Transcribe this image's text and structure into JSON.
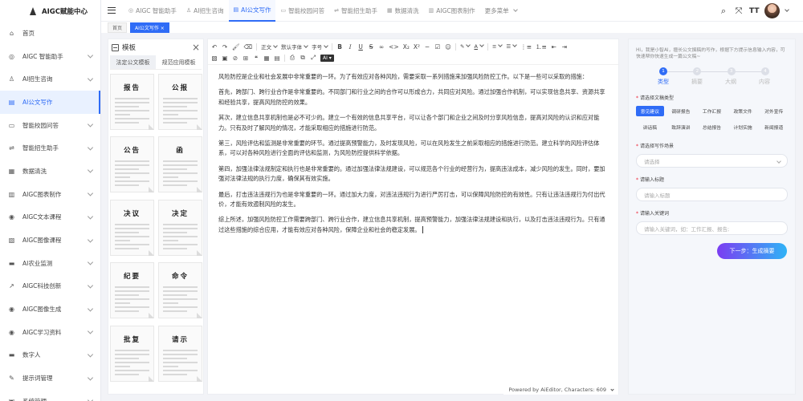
{
  "app": {
    "title": "AIGC赋能中心"
  },
  "sidebar": {
    "items": [
      {
        "label": "首页",
        "icon": "home-icon",
        "glyph": "⌂"
      },
      {
        "label": "AIGC 智能助手",
        "icon": "github-icon",
        "glyph": "◎"
      },
      {
        "label": "AI招生咨询",
        "icon": "user-icon",
        "glyph": "♙"
      },
      {
        "label": "AI公文写作",
        "icon": "document-icon",
        "glyph": "▤"
      },
      {
        "label": "智能校园问答",
        "icon": "chat-icon",
        "glyph": "▭"
      },
      {
        "label": "智能招生助手",
        "icon": "switch-icon",
        "glyph": "⇌"
      },
      {
        "label": "数据清洗",
        "icon": "table-icon",
        "glyph": "▦"
      },
      {
        "label": "AIGC图表制作",
        "icon": "chart-icon",
        "glyph": "▥"
      },
      {
        "label": "AIGC文本课程",
        "icon": "aperture-icon",
        "glyph": "◉"
      },
      {
        "label": "AIGC图像课程",
        "icon": "picture-icon",
        "glyph": "▧"
      },
      {
        "label": "AI农业监测",
        "icon": "monitor-icon",
        "glyph": "▬"
      },
      {
        "label": "AIGC科技创新",
        "icon": "external-link-icon",
        "glyph": "↗"
      },
      {
        "label": "AIGC图像生成",
        "icon": "aperture-icon",
        "glyph": "◉"
      },
      {
        "label": "AIGC学习资料",
        "icon": "aperture-icon",
        "glyph": "◉"
      },
      {
        "label": "数字人",
        "icon": "folder-icon",
        "glyph": "▬"
      },
      {
        "label": "提示词管理",
        "icon": "edit-icon",
        "glyph": "✎"
      },
      {
        "label": "系统管理",
        "icon": "briefcase-icon",
        "glyph": "▣"
      }
    ]
  },
  "header": {
    "tabs": [
      {
        "label": "AIGC 智能助手",
        "glyph": "◎"
      },
      {
        "label": "AI招生咨询",
        "glyph": "♙"
      },
      {
        "label": "AI公文写作",
        "glyph": "▤"
      },
      {
        "label": "智能校园问答",
        "glyph": "▭"
      },
      {
        "label": "智能招生助手",
        "glyph": "⇌"
      },
      {
        "label": "数据清洗",
        "glyph": "▦"
      },
      {
        "label": "AIGC图表制作",
        "glyph": "▥"
      }
    ],
    "more": "更多菜单"
  },
  "breadcrumb": {
    "home": "首页",
    "current": "AI公文写作 ×"
  },
  "templates": {
    "title": "模板",
    "tabs": [
      "法定公文模板",
      "规范应用模板"
    ],
    "cards": [
      "报告",
      "公报",
      "公告",
      "函",
      "决议",
      "决定",
      "纪要",
      "命令",
      "批复",
      "请示"
    ]
  },
  "editor": {
    "toolbar": {
      "heading": "正文",
      "font": "默认字体",
      "size": "字号",
      "ai": "AI"
    },
    "paragraphs": [
      "风险防控是企业和社会发展中非常重要的一环。为了有效应对各种风险，需要采取一系列措施来加强风险防控工作。以下是一些可以采取的措施：",
      "首先，跨部门、跨行业合作是非常重要的。不同部门和行业之间的合作可以形成合力，共同应对风险。通过加强合作机制，可以实现信息共享、资源共享和经验共享，提高风险防控的效果。",
      "其次，建立信息共享机制也是必不可少的。建立一个有效的信息共享平台，可以让各个部门和企业之间及时分享风险信息，提高对风险的认识和应对能力。只有及时了解风险的情况，才能采取相应的措施进行防范。",
      "第三，风险评估和监测是非常重要的环节。通过提高预警能力，及时发现风险，可以在风险发生之前采取相应的措施进行防范。建立科学的风险评估体系，可以对各种风险进行全面的评估和监测，为风险防控提供科学依据。",
      "第四，加强法律法规制定和执行也是非常重要的。通过加强法律法规建设，可以规范各个行业的经营行为，提高违法成本，减少风险的发生。同时，要加强对法律法规的执行力度，确保其有效实施。",
      "最后，打击违法违规行为也是非常重要的一环。通过加大力度，对违法违规行为进行严厉打击，可以保障风险防控的有效性。只有让违法违规行为付出代价，才能有效遏制风险的发生。",
      "综上所述，加强风险防控工作需要跨部门、跨行业合作，建立信息共享机制，提高预警能力，加强法律法规建设和执行，以及打击违法违规行为。只有通过这些措施的综合应用，才能有效应对各种风险，保障企业和社会的稳定发展。"
    ],
    "footer": "Powered by AiEditor, Characters: 609"
  },
  "form": {
    "hint": "Hi，我是小智AI，擅长公文撰稿的写作，根据下方提示信息输入内容，可快速帮你快速生成一篇公文稿~",
    "steps": [
      {
        "num": "1",
        "label": "类型"
      },
      {
        "num": "2",
        "label": "摘要"
      },
      {
        "num": "3",
        "label": "大纲"
      },
      {
        "num": "4",
        "label": "内容"
      }
    ],
    "type_label": "请选择文稿类型",
    "types": [
      "意见建议",
      "调研报告",
      "工作汇报",
      "政策文件",
      "对外宣传",
      "讲话稿",
      "致辞演讲",
      "总结报告",
      "计划实施",
      "新闻报道"
    ],
    "scene_label": "请选择写作场景",
    "scene_placeholder": "请选择",
    "title_label": "请输入标题",
    "title_placeholder": "请输入标题",
    "keyword_label": "请输入关键词",
    "keyword_placeholder": "请输入关键词，如：工作汇报、报告;",
    "next_button": "下一步：生成摘要"
  }
}
